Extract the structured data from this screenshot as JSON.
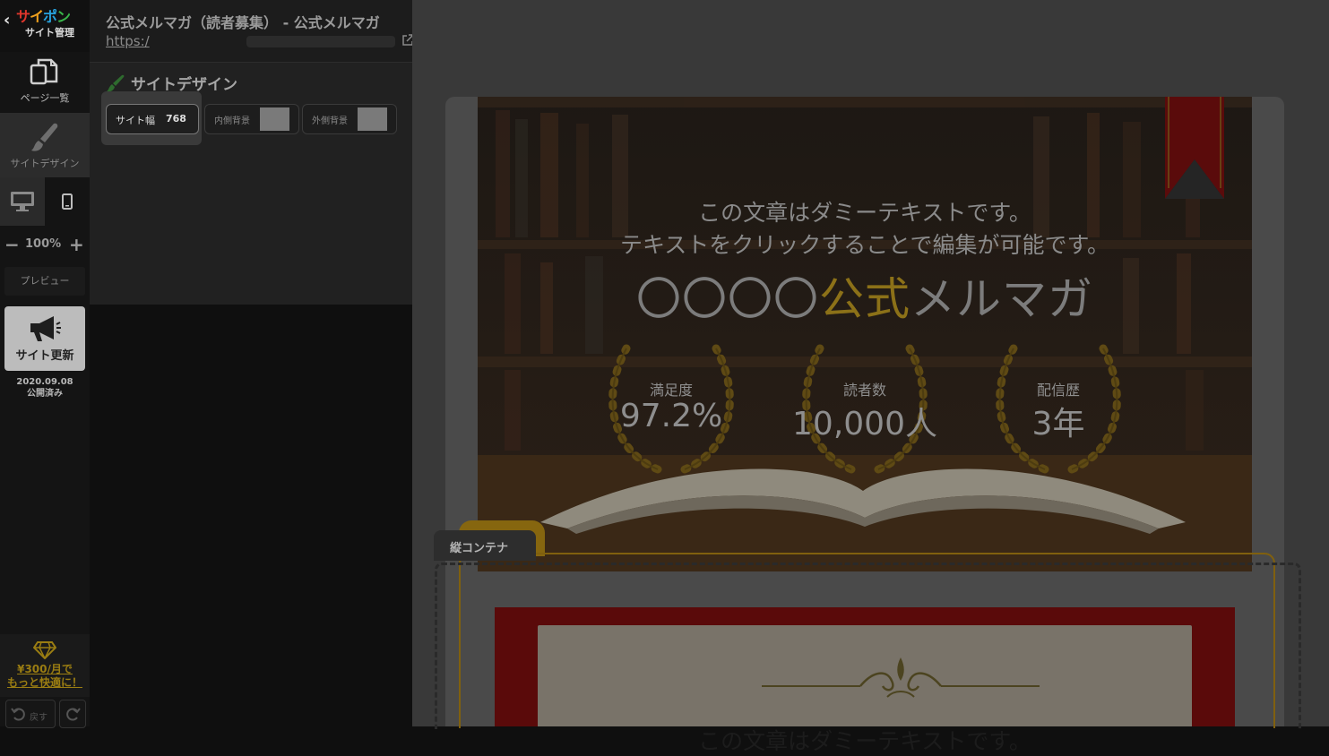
{
  "app": {
    "logo_text": "サイポン",
    "logo_sub": "サイト管理",
    "back_icon": "chevron-left-icon"
  },
  "rail": {
    "pages_label": "ページ一覧",
    "design_label": "サイトデザイン",
    "zoom": "100%",
    "preview_label": "プレビュー",
    "update_label": "サイト更新",
    "published_date": "2020.09.08",
    "published_status": "公開済み",
    "premium_line1": "¥300/月で",
    "premium_line2": "もっと快適に！",
    "undo_label": "戻す"
  },
  "panel": {
    "site_title": "公式メルマガ（読者募集） - 公式メルマガ",
    "site_url": "https:/",
    "section_title": "サイトデザイン",
    "width_label": "サイト幅",
    "width_value": "768",
    "inner_bg_label": "内側背景",
    "outer_bg_label": "外側背景",
    "swatch_color": "#7a7a7a"
  },
  "hero": {
    "line1": "この文章はダミーテキストです。",
    "line2": "テキストをクリックすることで編集が可能です。",
    "title_prefix": "〇〇〇〇",
    "title_accent": "公式",
    "title_suffix": "メルマガ",
    "stats": [
      {
        "label": "満足度",
        "value": "97.2%"
      },
      {
        "label": "読者数",
        "value": "10,000人"
      },
      {
        "label": "配信歴",
        "value": "3年"
      }
    ]
  },
  "container": {
    "tab_label": "縦コンテナ",
    "cert_text": "この文章はダミーテキストです。"
  },
  "colors": {
    "accent_gold": "#8c7118",
    "panel_bg": "#212121",
    "canvas_bg": "#393939"
  }
}
